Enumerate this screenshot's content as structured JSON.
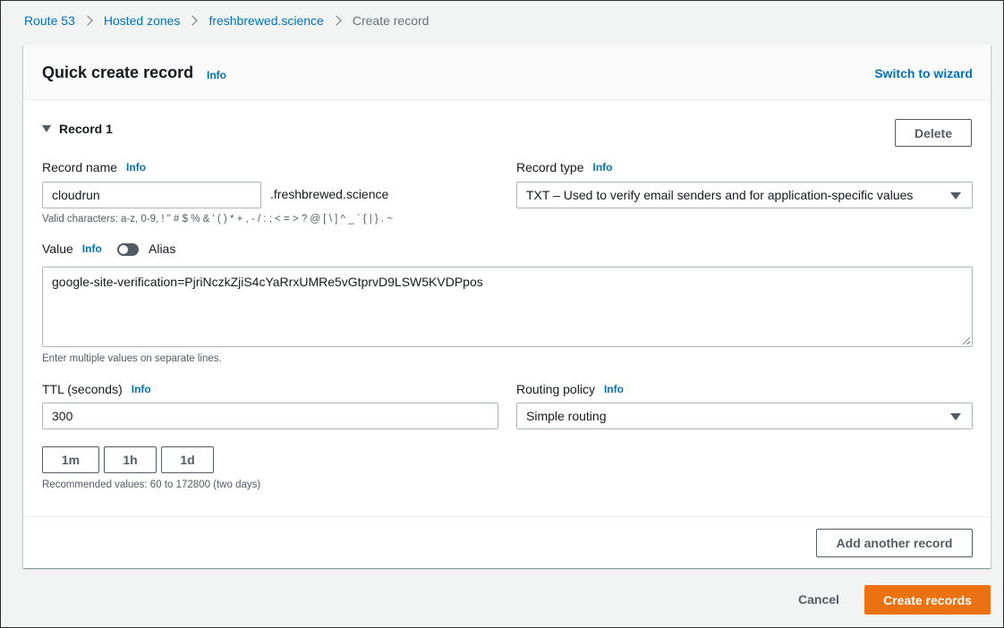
{
  "breadcrumb": {
    "items": [
      "Route 53",
      "Hosted zones",
      "freshbrewed.science"
    ],
    "current": "Create record"
  },
  "header": {
    "title": "Quick create record",
    "info": "Info",
    "switch_link": "Switch to wizard"
  },
  "record": {
    "toggle_label": "Record 1",
    "delete_label": "Delete",
    "name": {
      "label": "Record name",
      "info": "Info",
      "value": "cloudrun",
      "suffix": ".freshbrewed.science",
      "hint": "Valid characters: a-z, 0-9, ! \" # $ % & ' ( ) * + , - / : ; < = > ? @ [ \\ ] ^ _ ` { | } . ~"
    },
    "type": {
      "label": "Record type",
      "info": "Info",
      "value": "TXT – Used to verify email senders and for application-specific values"
    },
    "value": {
      "label": "Value",
      "info": "Info",
      "alias_label": "Alias",
      "text": "google-site-verification=PjriNczkZjiS4cYaRrxUMRe5vGtprvD9LSW5KVDPpos",
      "hint": "Enter multiple values on separate lines."
    },
    "ttl": {
      "label": "TTL (seconds)",
      "info": "Info",
      "value": "300",
      "presets": [
        "1m",
        "1h",
        "1d"
      ],
      "hint": "Recommended values: 60 to 172800 (two days)"
    },
    "routing": {
      "label": "Routing policy",
      "info": "Info",
      "value": "Simple routing"
    }
  },
  "add_another_label": "Add another record",
  "footer": {
    "cancel_label": "Cancel",
    "create_label": "Create records"
  },
  "colors": {
    "link": "#0073bb",
    "primary_button": "#ec7211",
    "text": "#16191f",
    "secondary_text": "#545b64"
  }
}
